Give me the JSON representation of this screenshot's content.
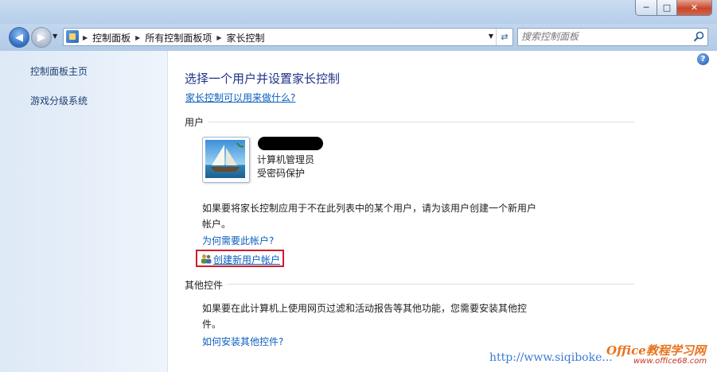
{
  "window": {
    "min_glyph": "─",
    "max_glyph": "□",
    "close_glyph": "✕"
  },
  "nav": {
    "breadcrumbs": [
      "控制面板",
      "所有控制面板项",
      "家长控制"
    ],
    "search_placeholder": "搜索控制面板"
  },
  "sidebar": {
    "items": [
      {
        "label": "控制面板主页"
      },
      {
        "label": "游戏分级系统"
      }
    ]
  },
  "main": {
    "help_glyph": "?",
    "title": "选择一个用户并设置家长控制",
    "what_can_do_link": "家长控制可以用来做什么?",
    "users_section": "用户",
    "account": {
      "name_redacted": true,
      "role": "计算机管理员",
      "password_status": "受密码保护"
    },
    "add_user_text": "如果要将家长控制应用于不在此列表中的某个用户，请为该用户创建一个新用户帐户。",
    "why_account_link": "为何需要此帐户?",
    "create_account_link": "创建新用户帐户",
    "other_controls_section": "其他控件",
    "other_controls_text": "如果要在此计算机上使用网页过滤和活动报告等其他功能，您需要安装其他控件。",
    "how_install_link": "如何安装其他控件?"
  },
  "watermark": {
    "url": "http://www.siqiboke...",
    "logo": "Office教程学习网",
    "sub": "www.office68.com"
  },
  "colors": {
    "title_blue": "#1e3287",
    "link_blue": "#0a5fbf",
    "sidebar_link": "#1e3f73",
    "highlight_red": "#d01a2a"
  },
  "icons": {
    "back": "left-arrow-icon",
    "forward": "right-arrow-icon",
    "refresh": "refresh-icon",
    "search": "magnifier-icon",
    "help": "help-icon",
    "avatar": "sailboat-user-picture",
    "create_user": "users-icon"
  }
}
